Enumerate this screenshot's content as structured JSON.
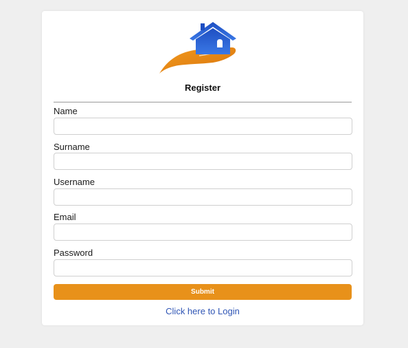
{
  "form": {
    "title": "Register",
    "fields": [
      {
        "label": "Name",
        "value": "",
        "placeholder": ""
      },
      {
        "label": "Surname",
        "value": "",
        "placeholder": ""
      },
      {
        "label": "Username",
        "value": "",
        "placeholder": ""
      },
      {
        "label": "Email",
        "value": "",
        "placeholder": ""
      },
      {
        "label": "Password",
        "value": "",
        "placeholder": ""
      }
    ],
    "submit_label": "Submit",
    "login_link": "Click here to Login"
  },
  "logo": {
    "icon": "house-in-hand-icon"
  },
  "colors": {
    "accent": "#e8911a",
    "link": "#2f55b5",
    "logo_blue": "#2a5fd0",
    "background": "#efefef",
    "card": "#ffffff"
  }
}
